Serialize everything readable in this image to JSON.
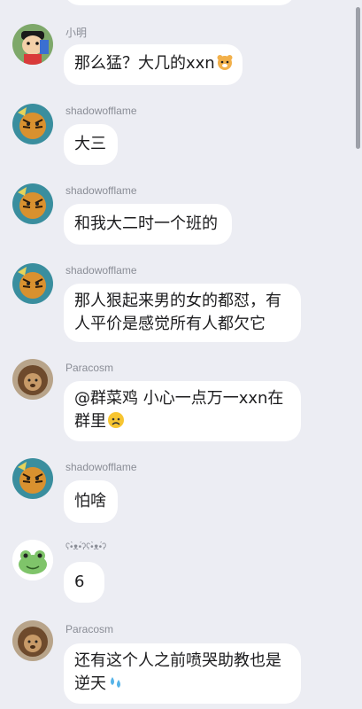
{
  "messages": [
    {
      "sender": "小明",
      "lines": [
        "那么猛？大几的xxn"
      ],
      "emoji": "hamster-emoji"
    },
    {
      "sender": "shadowofflame",
      "lines": [
        "大三"
      ]
    },
    {
      "sender": "shadowofflame",
      "lines": [
        "和我大二时一个班的"
      ]
    },
    {
      "sender": "shadowofflame",
      "lines": [
        "那人狠起来男的女的都怼，有",
        "人平价是感觉所有人都欠它"
      ]
    },
    {
      "sender": "Paracosm",
      "lines": [
        "@群菜鸡 小心一点万一xxn在",
        "群里"
      ],
      "emoji": "worried-face-emoji"
    },
    {
      "sender": "shadowofflame",
      "lines": [
        "怕啥"
      ]
    },
    {
      "sender": "ʕ•̀ᴥ•́ʔʕ•̀ᴥ•́ʔ",
      "lines": [
        "6"
      ]
    },
    {
      "sender": "Paracosm",
      "lines": [
        "还有这个人之前喷哭助教也是",
        "逆天"
      ],
      "emoji": "sweat-droplets-emoji"
    }
  ]
}
